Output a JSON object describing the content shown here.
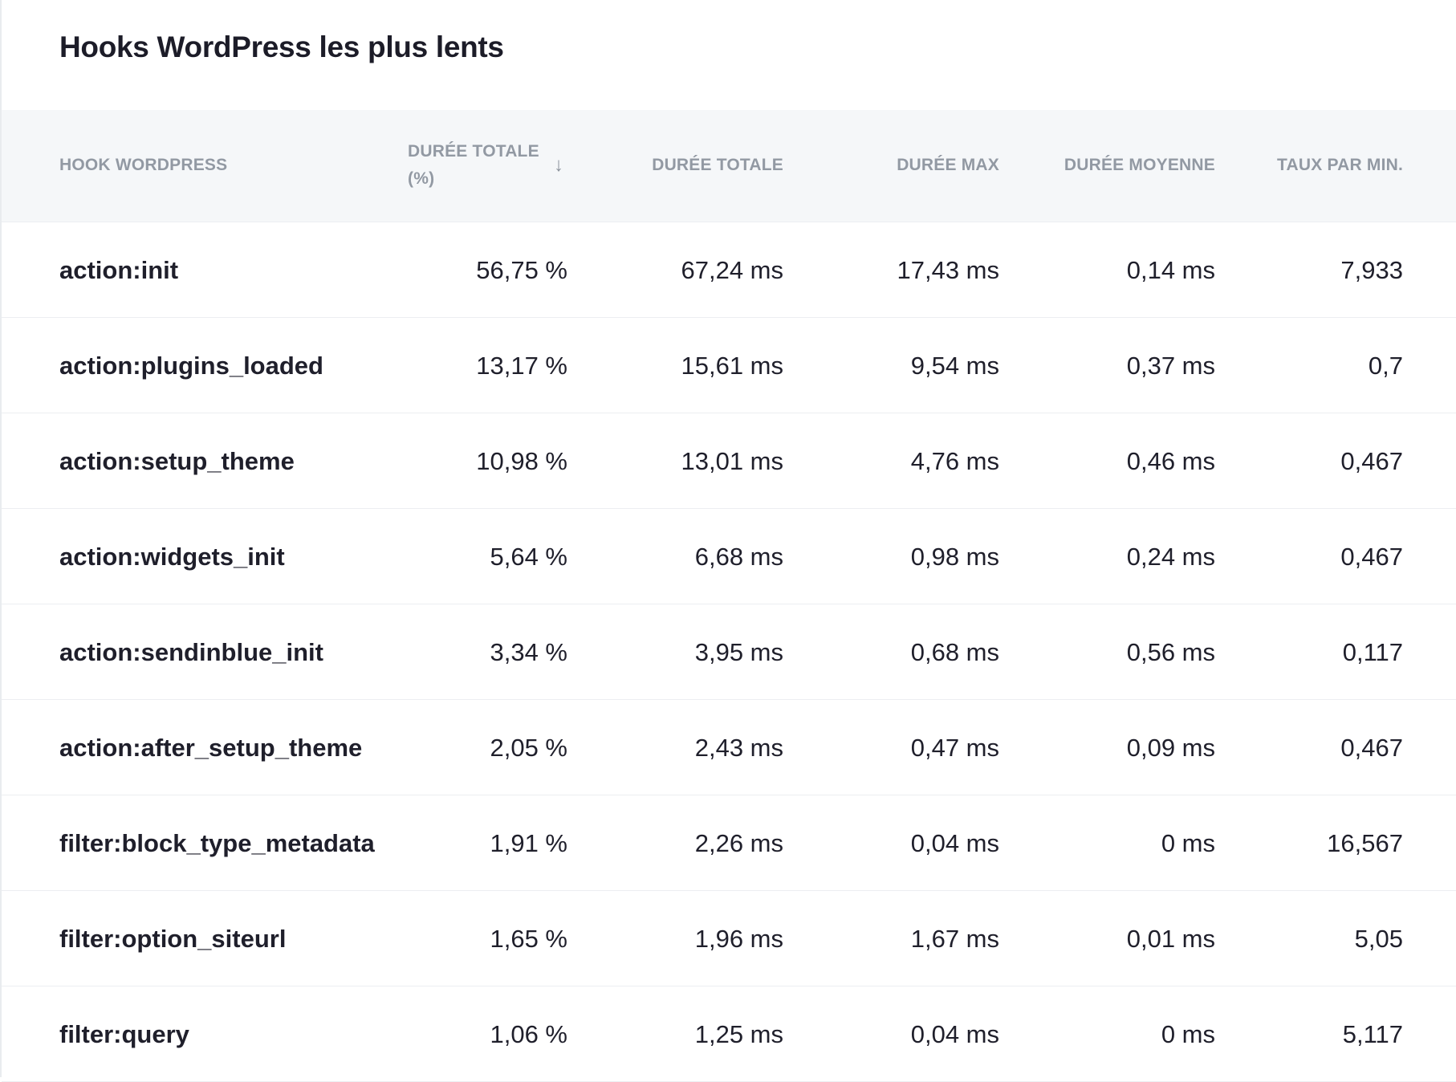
{
  "panel": {
    "title": "Hooks WordPress les plus lents"
  },
  "table": {
    "headers": {
      "hook": "HOOK WORDPRESS",
      "total_pct": "DURÉE TOTALE (%)",
      "total": "DURÉE TOTALE",
      "max": "DURÉE MAX",
      "avg": "DURÉE MOYENNE",
      "rate": "TAUX PAR MIN."
    },
    "sort_icon": "arrow-down-icon",
    "rows": [
      {
        "hook": "action:init",
        "total_pct": "56,75 %",
        "total": "67,24 ms",
        "max": "17,43 ms",
        "avg": "0,14 ms",
        "rate": "7,933"
      },
      {
        "hook": "action:plugins_loaded",
        "total_pct": "13,17 %",
        "total": "15,61 ms",
        "max": "9,54 ms",
        "avg": "0,37 ms",
        "rate": "0,7"
      },
      {
        "hook": "action:setup_theme",
        "total_pct": "10,98 %",
        "total": "13,01 ms",
        "max": "4,76 ms",
        "avg": "0,46 ms",
        "rate": "0,467"
      },
      {
        "hook": "action:widgets_init",
        "total_pct": "5,64 %",
        "total": "6,68 ms",
        "max": "0,98 ms",
        "avg": "0,24 ms",
        "rate": "0,467"
      },
      {
        "hook": "action:sendinblue_init",
        "total_pct": "3,34 %",
        "total": "3,95 ms",
        "max": "0,68 ms",
        "avg": "0,56 ms",
        "rate": "0,117"
      },
      {
        "hook": "action:after_setup_theme",
        "total_pct": "2,05 %",
        "total": "2,43 ms",
        "max": "0,47 ms",
        "avg": "0,09 ms",
        "rate": "0,467"
      },
      {
        "hook": "filter:block_type_metadata",
        "total_pct": "1,91 %",
        "total": "2,26 ms",
        "max": "0,04 ms",
        "avg": "0 ms",
        "rate": "16,567"
      },
      {
        "hook": "filter:option_siteurl",
        "total_pct": "1,65 %",
        "total": "1,96 ms",
        "max": "1,67 ms",
        "avg": "0,01 ms",
        "rate": "5,05"
      },
      {
        "hook": "filter:query",
        "total_pct": "1,06 %",
        "total": "1,25 ms",
        "max": "0,04 ms",
        "avg": "0 ms",
        "rate": "5,117"
      }
    ]
  }
}
